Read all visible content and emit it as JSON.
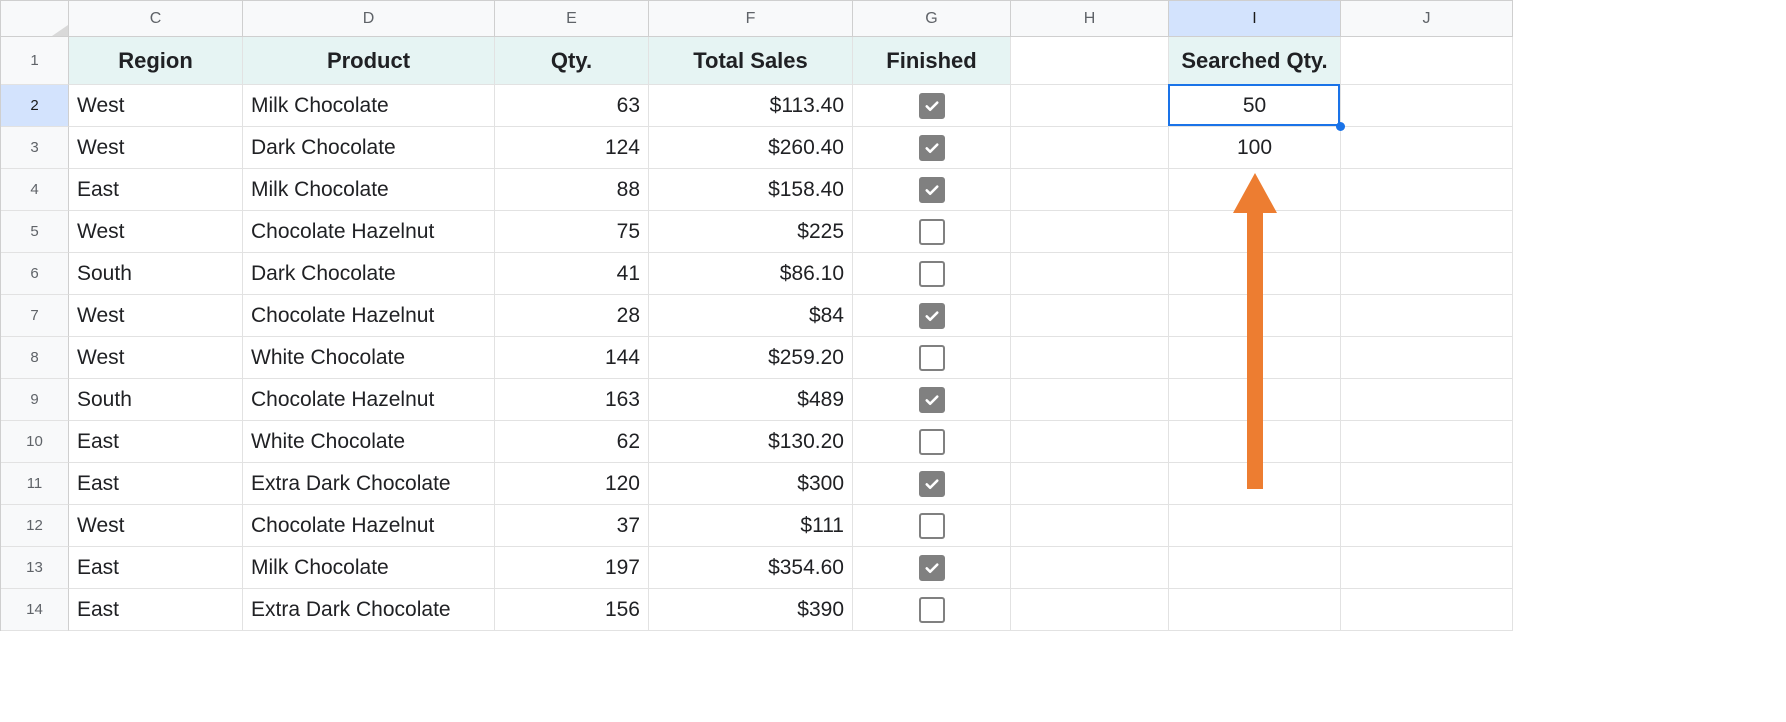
{
  "sheet": {
    "colLetters": [
      "C",
      "D",
      "E",
      "F",
      "G",
      "H",
      "I",
      "J"
    ],
    "rowNumbers": [
      "1",
      "2",
      "3",
      "4",
      "5",
      "6",
      "7",
      "8",
      "9",
      "10",
      "11",
      "12",
      "13",
      "14"
    ],
    "selectedColIndex": 6,
    "selectedRowIndex": 1,
    "headers": {
      "C": "Region",
      "D": "Product",
      "E": "Qty.",
      "F": "Total Sales",
      "G": "Finished",
      "I": "Searched Qty."
    },
    "rows": [
      {
        "region": "West",
        "product": "Milk Chocolate",
        "qty": "63",
        "sales": "$113.40",
        "finished": true,
        "searched": "50"
      },
      {
        "region": "West",
        "product": "Dark Chocolate",
        "qty": "124",
        "sales": "$260.40",
        "finished": true,
        "searched": "100"
      },
      {
        "region": "East",
        "product": "Milk Chocolate",
        "qty": "88",
        "sales": "$158.40",
        "finished": true,
        "searched": ""
      },
      {
        "region": "West",
        "product": "Chocolate Hazelnut",
        "qty": "75",
        "sales": "$225",
        "finished": false,
        "searched": ""
      },
      {
        "region": "South",
        "product": "Dark Chocolate",
        "qty": "41",
        "sales": "$86.10",
        "finished": false,
        "searched": ""
      },
      {
        "region": "West",
        "product": "Chocolate Hazelnut",
        "qty": "28",
        "sales": "$84",
        "finished": true,
        "searched": ""
      },
      {
        "region": "West",
        "product": "White Chocolate",
        "qty": "144",
        "sales": "$259.20",
        "finished": false,
        "searched": ""
      },
      {
        "region": "South",
        "product": "Chocolate Hazelnut",
        "qty": "163",
        "sales": "$489",
        "finished": true,
        "searched": ""
      },
      {
        "region": "East",
        "product": "White Chocolate",
        "qty": "62",
        "sales": "$130.20",
        "finished": false,
        "searched": ""
      },
      {
        "region": "East",
        "product": "Extra Dark Chocolate",
        "qty": "120",
        "sales": "$300",
        "finished": true,
        "searched": ""
      },
      {
        "region": "West",
        "product": "Chocolate Hazelnut",
        "qty": "37",
        "sales": "$111",
        "finished": false,
        "searched": ""
      },
      {
        "region": "East",
        "product": "Milk Chocolate",
        "qty": "197",
        "sales": "$354.60",
        "finished": true,
        "searched": ""
      },
      {
        "region": "East",
        "product": "Extra Dark Chocolate",
        "qty": "156",
        "sales": "$390",
        "finished": false,
        "searched": ""
      }
    ]
  },
  "annotation": {
    "arrowColor": "#ed7d31"
  }
}
